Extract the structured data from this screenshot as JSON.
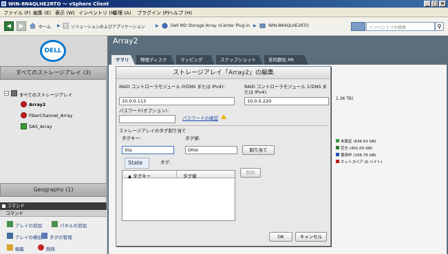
{
  "window": {
    "title": "WIN-8N4QLHE2RTO 〜 vSphere Client"
  },
  "menu": [
    "ファイル (F)",
    "編集 (E)",
    "表示 (W)",
    "インベントリ (N)",
    "管理 (A)",
    "プラグイン (P)",
    "ヘルプ (H)"
  ],
  "breadcrumb": {
    "home": "ホーム",
    "solutions": "ソリューションおよびアプリケーション",
    "plugin": "Dell MD Storage Array vCenter Plug-in",
    "host": "WIN-8N4QLHE2RTO"
  },
  "search": {
    "placeholder": "インベントリの検索"
  },
  "sidebar": {
    "logo": "DELL",
    "header": "すべてのストレージアレイ (3)",
    "tree_root": "すべてのストレージアレイ",
    "arrays": [
      "Array2",
      "FiberChannel_Array",
      "SAS_Array"
    ],
    "geography": "Geography (1)",
    "commands_title": "コマンド",
    "commands_sub": "コマンド",
    "cmd_add_array": "アレイの追加",
    "cmd_add_panel": "パネルの追加",
    "cmd_detect_array": "アレイの検出",
    "cmd_manage_tags": "タグの管理",
    "cmd_edit": "編集",
    "cmd_delete": "削除"
  },
  "main": {
    "title": "Array2",
    "tabs": [
      "サマリ",
      "物理ディスク",
      "マッピング",
      "スナップショット",
      "非同期化 RR"
    ],
    "capacity_text": "1.36 TB)",
    "legend": [
      {
        "label": "未設定 (836.63 GB)",
        "color": "#3c9b3c"
      },
      {
        "label": "空き (401.00 GB)",
        "color": "#2d7a2d"
      },
      {
        "label": "使用中 (156.79 GB)",
        "color": "#1f4fb8"
      },
      {
        "label": "ホットスペア (0 バイト)",
        "color": "#c01b1b"
      }
    ]
  },
  "dialog": {
    "title": "ストレージアレイ「Array2」の編集",
    "ctrl0_label": "RAID コントローラモジュール 0(DNS または IPv4):",
    "ctrl0_value": "10.0.0.113",
    "ctrl1_label": "RAID コントローラモジュール 1(DNS または IPv4):",
    "ctrl1_value": "10.0.0.220",
    "password_label": "パスワード(オプション):",
    "password_value": "",
    "password_confirm_link": "パスワードの確認",
    "tag_section": "ストレージアレイのタグ割り当て",
    "tag_key_label": "タグキー:",
    "tag_key_value": "Sta",
    "tag_value_label": "タグ値:",
    "tag_value_value": "Ohio",
    "assign_button": "割り当て",
    "existing_tags_label": "タグ:",
    "autocomplete_option": "State",
    "col_key": "▲ タグキー",
    "col_value": "タグ値",
    "delete_button": "削除",
    "ok_button": "OK",
    "cancel_button": "キャンセル"
  }
}
